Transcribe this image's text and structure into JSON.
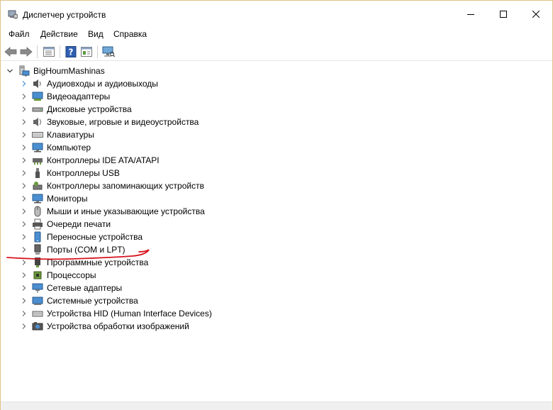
{
  "window": {
    "title": "Диспетчер устройств"
  },
  "menu": {
    "items": [
      "Файл",
      "Действие",
      "Вид",
      "Справка"
    ]
  },
  "toolbar": {
    "buttons": [
      "back-arrow-icon",
      "forward-arrow-icon",
      "properties-icon",
      "help-icon",
      "update-driver-icon",
      "scan-hardware-icon"
    ]
  },
  "tree": {
    "root": "BigHoumMashinas",
    "categories": [
      "Аудиовходы и аудиовыходы",
      "Видеоадаптеры",
      "Дисковые устройства",
      "Звуковые, игровые и видеоустройства",
      "Клавиатуры",
      "Компьютер",
      "Контроллеры IDE ATA/ATAPI",
      "Контроллеры USB",
      "Контроллеры запоминающих устройств",
      "Мониторы",
      "Мыши и иные указывающие устройства",
      "Очереди печати",
      "Переносные устройства",
      "Порты (COM и LPT)",
      "Программные устройства",
      "Процессоры",
      "Сетевые адаптеры",
      "Системные устройства",
      "Устройства HID (Human Interface Devices)",
      "Устройства обработки изображений"
    ],
    "icons": [
      "speaker-icon",
      "display-adapter-icon",
      "disk-drive-icon",
      "sound-icon",
      "keyboard-icon",
      "computer-icon",
      "ide-controller-icon",
      "usb-icon",
      "storage-controller-icon",
      "monitor-icon",
      "mouse-icon",
      "printer-icon",
      "portable-device-icon",
      "port-icon",
      "software-device-icon",
      "processor-icon",
      "network-adapter-icon",
      "system-device-icon",
      "hid-icon",
      "imaging-device-icon"
    ]
  },
  "colors": {
    "window_border": "#e0c38a",
    "annotation": "#d8141e",
    "chevron": "#6a6a6a",
    "selected_chevron": "#3c8fd6"
  }
}
